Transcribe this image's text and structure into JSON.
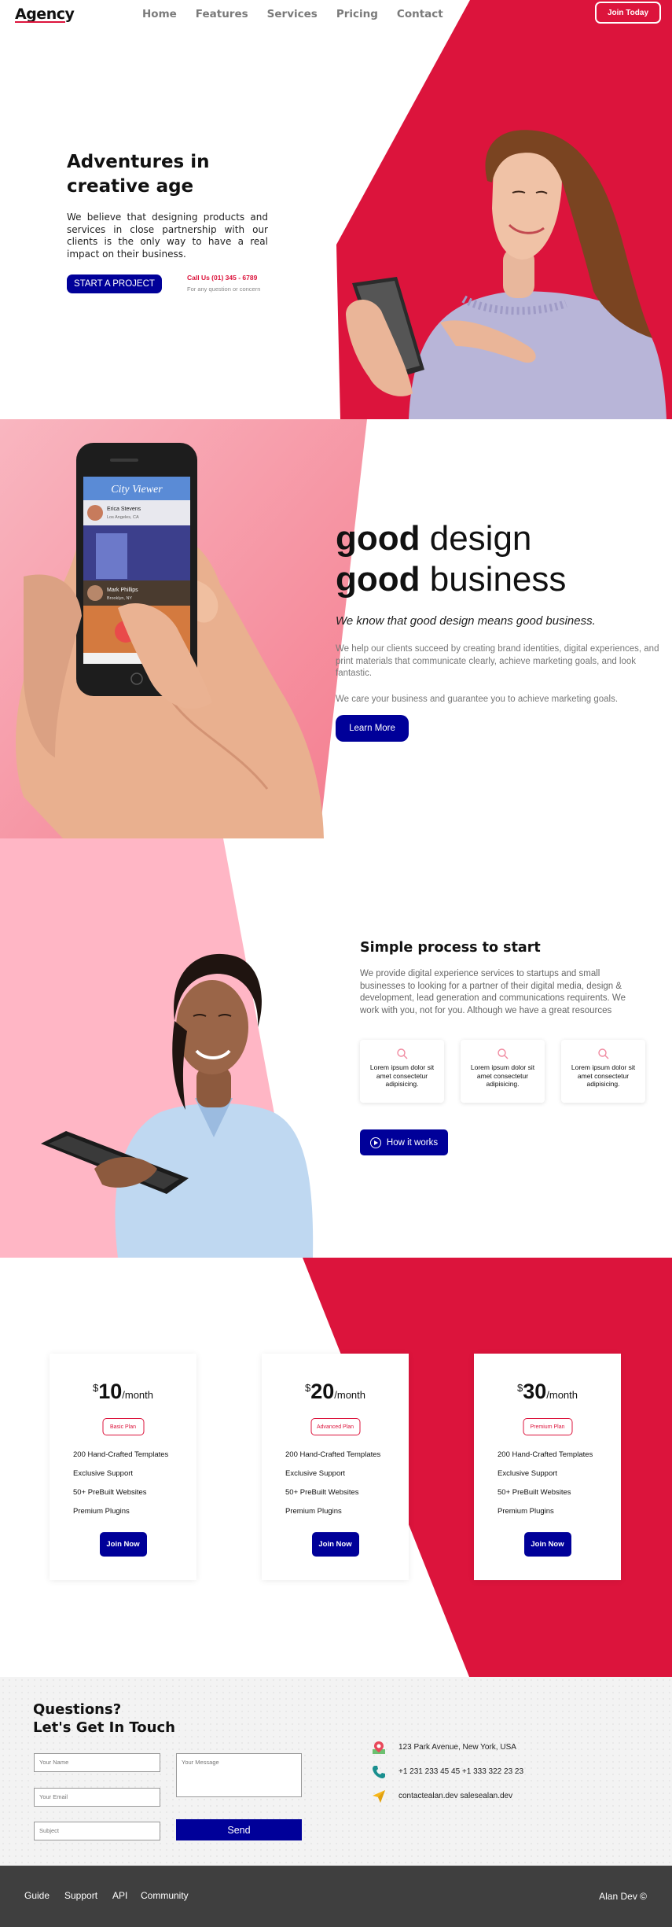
{
  "brand": {
    "logo": "Agency",
    "accent": "#dc143c",
    "primary": "#000099"
  },
  "nav": {
    "items": [
      "Home",
      "Features",
      "Services",
      "Pricing",
      "Contact"
    ],
    "join_label": "Join Today"
  },
  "hero": {
    "title_line1": "Adventures in",
    "title_line2": "creative age",
    "text": "We believe that designing products and services in close partnership with our clients is the only way to have a real impact on their business.",
    "cta": "START A PROJECT",
    "call": "Call Us (01) 345 - 6789",
    "call_note": "For any question or concern"
  },
  "design": {
    "line1_bold": "good",
    "line1_rest": " design",
    "line2_bold": "good",
    "line2_rest": " business",
    "tagline": "We know that good design means good business.",
    "p1": "We help our clients succeed by creating brand identities, digital experiences, and print materials that communicate clearly, achieve marketing goals, and look fantastic.",
    "p2": "We care your business and guarantee you to achieve marketing goals.",
    "cta": "Learn More",
    "phone_app": {
      "title": "City Viewer",
      "user1": "Erica Stevens",
      "user1_loc": "Los Angeles, CA",
      "user2": "Mark Phillips",
      "user2_loc": "Brooklyn, NY"
    }
  },
  "process": {
    "title": "Simple process to start",
    "text": "We provide digital experience services to startups and small businesses to looking for a partner of their digital media, design & development, lead generation and communications requirents. We work with you, not for you. Although we have a great resources",
    "cards": [
      "Lorem ipsum dolor sit amet consectetur adipisicing.",
      "Lorem ipsum dolor sit amet consectetur adipisicing.",
      "Lorem ipsum dolor sit amet consectetur adipisicing."
    ],
    "card_icon": "search-icon",
    "cta": "How it works"
  },
  "pricing": {
    "plans": [
      {
        "currency": "$",
        "amount": "10",
        "period": "/month",
        "name": "Basic Plan",
        "features": [
          "200 Hand-Crafted Templates",
          "Exclusive Support",
          "50+ PreBuilt Websites",
          "Premium Plugins"
        ],
        "cta": "Join Now"
      },
      {
        "currency": "$",
        "amount": "20",
        "period": "/month",
        "name": "Advanced Plan",
        "features": [
          "200 Hand-Crafted Templates",
          "Exclusive Support",
          "50+ PreBuilt Websites",
          "Premium Plugins"
        ],
        "cta": "Join Now"
      },
      {
        "currency": "$",
        "amount": "30",
        "period": "/month",
        "name": "Premium Plan",
        "features": [
          "200 Hand-Crafted Templates",
          "Exclusive Support",
          "50+ PreBuilt Websites",
          "Premium Plugins"
        ],
        "cta": "Join Now"
      }
    ]
  },
  "contact": {
    "title_line1": "Questions?",
    "title_line2": "Let's Get In Touch",
    "name_placeholder": "Your Name",
    "email_placeholder": "Your Email",
    "subject_placeholder": "Subject",
    "message_placeholder": "Your Message",
    "send": "Send",
    "address": "123 Park Avenue, New York, USA",
    "phone": "+1 231 233 45 45 +1 333 322 23 23",
    "email": "contactealan.dev salesealan.dev"
  },
  "footer": {
    "links": [
      "Guide",
      "Support",
      "API",
      "Community"
    ],
    "credit": "Alan Dev ©"
  }
}
